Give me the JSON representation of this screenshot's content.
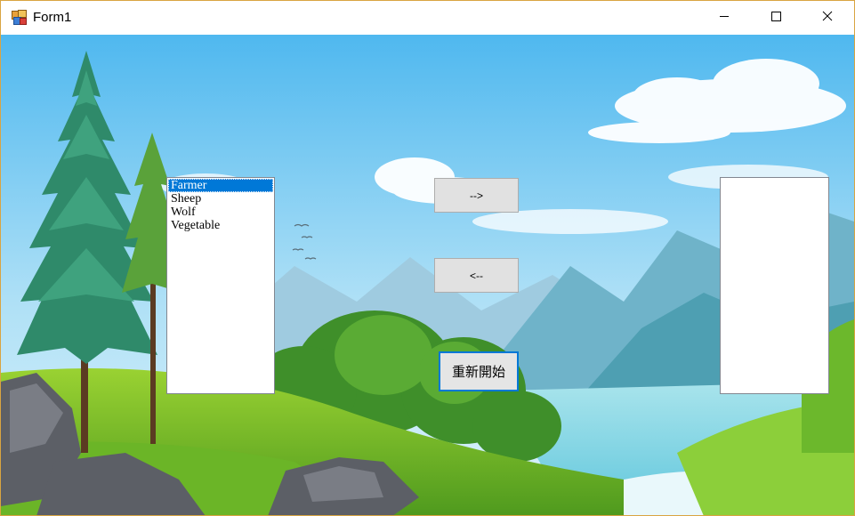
{
  "window": {
    "title": "Form1",
    "icon": "winforms-app-icon",
    "minimize_icon": "minimize-icon",
    "maximize_icon": "maximize-icon",
    "close_icon": "close-icon"
  },
  "left_list": {
    "items": [
      "Farmer",
      "Sheep",
      "Wolf",
      "Vegetable"
    ],
    "selected": "Farmer"
  },
  "right_list": {
    "items": []
  },
  "buttons": {
    "move_right": "-->",
    "move_left": "<--",
    "restart": "重新開始"
  },
  "colors": {
    "selection": "#0078d7",
    "window_border": "#d9a441",
    "focus_border": "#0078d7"
  }
}
